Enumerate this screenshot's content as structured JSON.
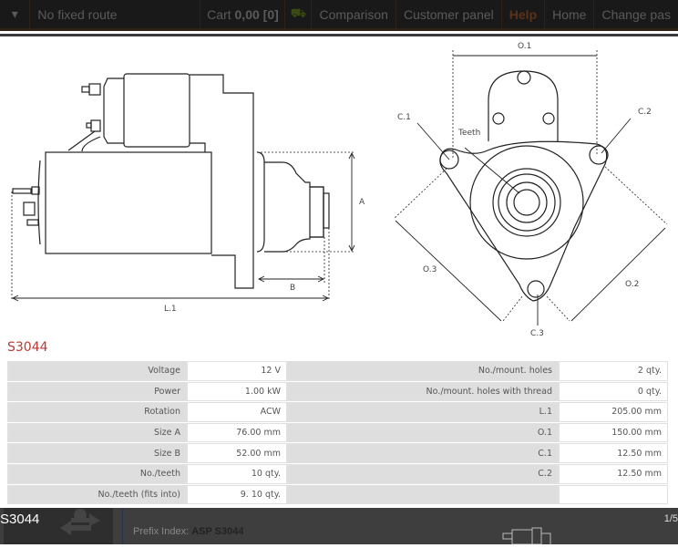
{
  "nav": {
    "route": "No fixed route",
    "cart_label": "Cart",
    "cart_value": "0,00 [0]",
    "comparison": "Comparison",
    "customer_panel": "Customer panel",
    "help": "Help",
    "home": "Home",
    "change_password": "Change pas",
    "help_color": "#5a3216",
    "truck_color": "#3a4a14"
  },
  "drawing": {
    "labels": {
      "o1": "O.1",
      "c1": "C.1",
      "c2": "C.2",
      "teeth": "Teeth",
      "a": "A",
      "b": "B",
      "l1": "L.1",
      "o3": "O.3",
      "o2": "O.2",
      "c3": "C.3"
    }
  },
  "product": {
    "code": "S3044",
    "specs_left": [
      {
        "label": "Voltage",
        "value": "12 V"
      },
      {
        "label": "Power",
        "value": "1.00 kW"
      },
      {
        "label": "Rotation",
        "value": "ACW"
      },
      {
        "label": "Size A",
        "value": "76.00 mm"
      },
      {
        "label": "Size B",
        "value": "52.00 mm"
      },
      {
        "label": "No./teeth",
        "value": "10 qty."
      },
      {
        "label": "No./teeth (fits into)",
        "value": "9. 10 qty."
      }
    ],
    "specs_right": [
      {
        "label": "No./mount. holes",
        "value": "2 qty."
      },
      {
        "label": "No./mount. holes with thread",
        "value": "0 qty."
      },
      {
        "label": "L.1",
        "value": "205.00 mm"
      },
      {
        "label": "O.1",
        "value": "150.00 mm"
      },
      {
        "label": "C.1",
        "value": "12.50 mm"
      },
      {
        "label": "C.2",
        "value": "12.50 mm"
      },
      {
        "label": "",
        "value": ""
      }
    ]
  },
  "bottom": {
    "code": "S3044",
    "prefix_label": "Prefix Index:",
    "prefix_value": "ASP S3044",
    "page": "1/5"
  }
}
